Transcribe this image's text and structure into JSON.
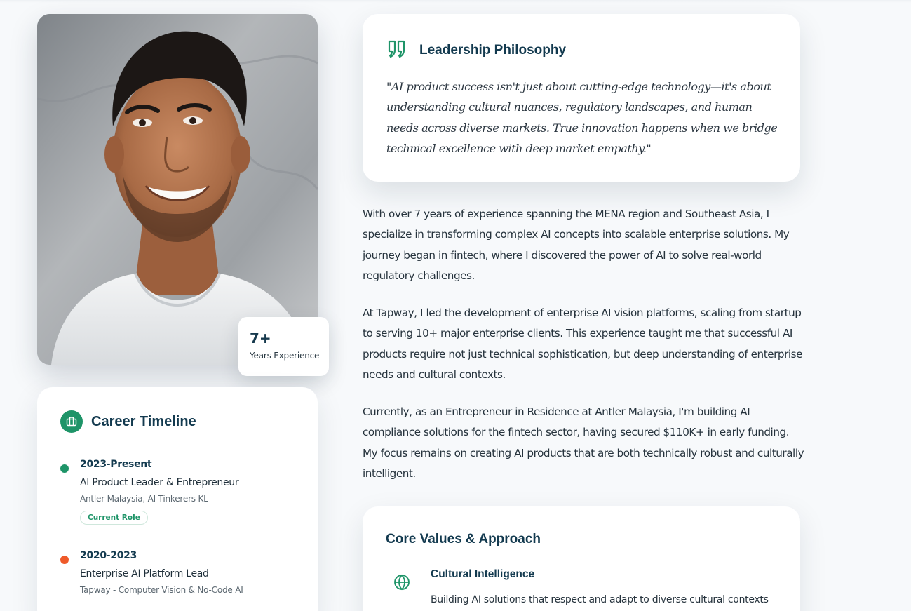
{
  "profile": {
    "photo_alt": "Portrait photo",
    "experience": {
      "value": "7+",
      "label": "Years Experience"
    }
  },
  "career": {
    "title": "Career Timeline",
    "icon": "briefcase-icon",
    "items": [
      {
        "years": "2023-Present",
        "role": "AI Product Leader & Entrepreneur",
        "org": "Antler Malaysia, AI Tinkerers KL",
        "tag": "Current Role",
        "dot_color": "#1e9468"
      },
      {
        "years": "2020-2023",
        "role": "Enterprise AI Platform Lead",
        "org": "Tapway - Computer Vision & No-Code AI",
        "dot_color": "#ef5a2a"
      }
    ]
  },
  "philosophy": {
    "title": "Leadership Philosophy",
    "icon": "quote-icon",
    "quote": "\"AI product success isn't just about cutting-edge technology—it's about understanding cultural nuances, regulatory landscapes, and human needs across diverse markets. True innovation happens when we bridge technical excellence with deep market empathy.\""
  },
  "bio": [
    "With over 7 years of experience spanning the MENA region and Southeast Asia, I specialize in transforming complex AI concepts into scalable enterprise solutions. My journey began in fintech, where I discovered the power of AI to solve real-world regulatory challenges.",
    "At Tapway, I led the development of enterprise AI vision platforms, scaling from startup to serving 10+ major enterprise clients. This experience taught me that successful AI products require not just technical sophistication, but deep understanding of enterprise needs and cultural contexts.",
    "Currently, as an Entrepreneur in Residence at Antler Malaysia, I'm building AI compliance solutions for the fintech sector, having secured $110K+ in early funding. My focus remains on creating AI products that are both technically robust and culturally intelligent."
  ],
  "values": {
    "title": "Core Values & Approach",
    "items": [
      {
        "icon": "globe-icon",
        "name": "Cultural Intelligence",
        "desc": "Building AI solutions that respect and adapt to diverse cultural contexts and market needs"
      }
    ]
  },
  "colors": {
    "accent": "#1e9468",
    "secondary": "#ef5a2a",
    "heading": "#133a4f"
  }
}
